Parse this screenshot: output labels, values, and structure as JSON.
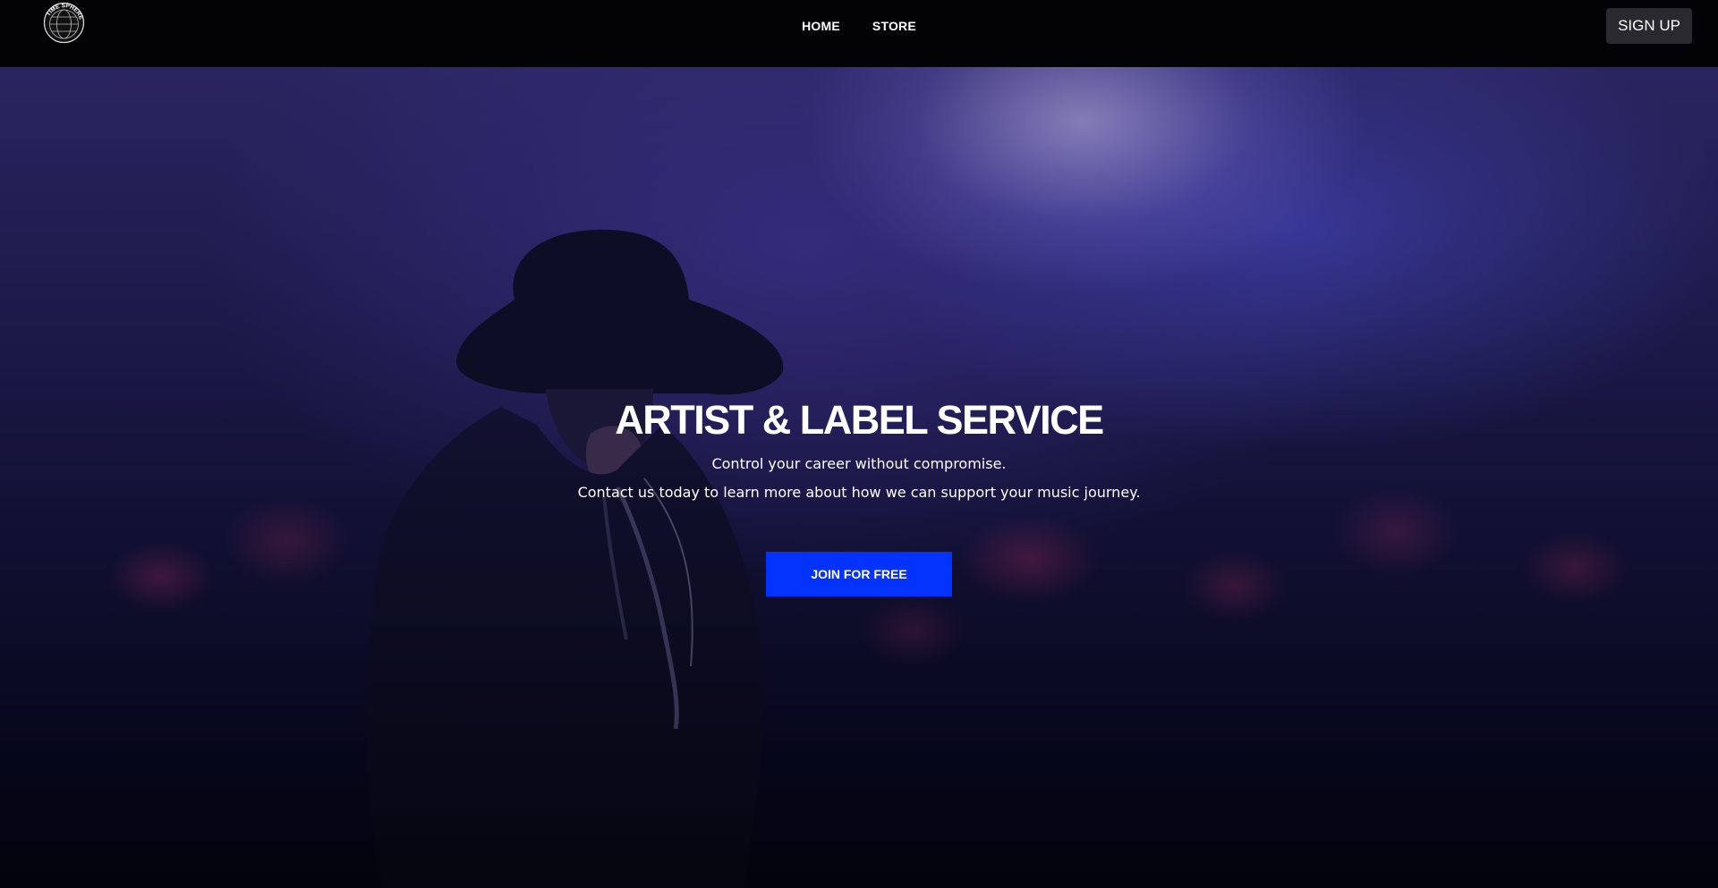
{
  "header": {
    "logo_text": "TIME SPHERE",
    "nav": [
      {
        "label": "HOME"
      },
      {
        "label": "STORE"
      }
    ],
    "signup_label": "SIGN UP"
  },
  "hero": {
    "title": "ARTIST & LABEL SERVICE",
    "subtitle_line1": "Control your career without compromise.",
    "subtitle_line2": "Contact us today to learn more about how we can support your music journey.",
    "cta_label": "JOIN FOR FREE",
    "background_image": "concert-performer-silhouette"
  },
  "colors": {
    "header_bg": "#030306",
    "cta_bg": "#0433ff",
    "signup_bg": "#2a2a2e",
    "hero_tint": "#1c1a4a"
  }
}
